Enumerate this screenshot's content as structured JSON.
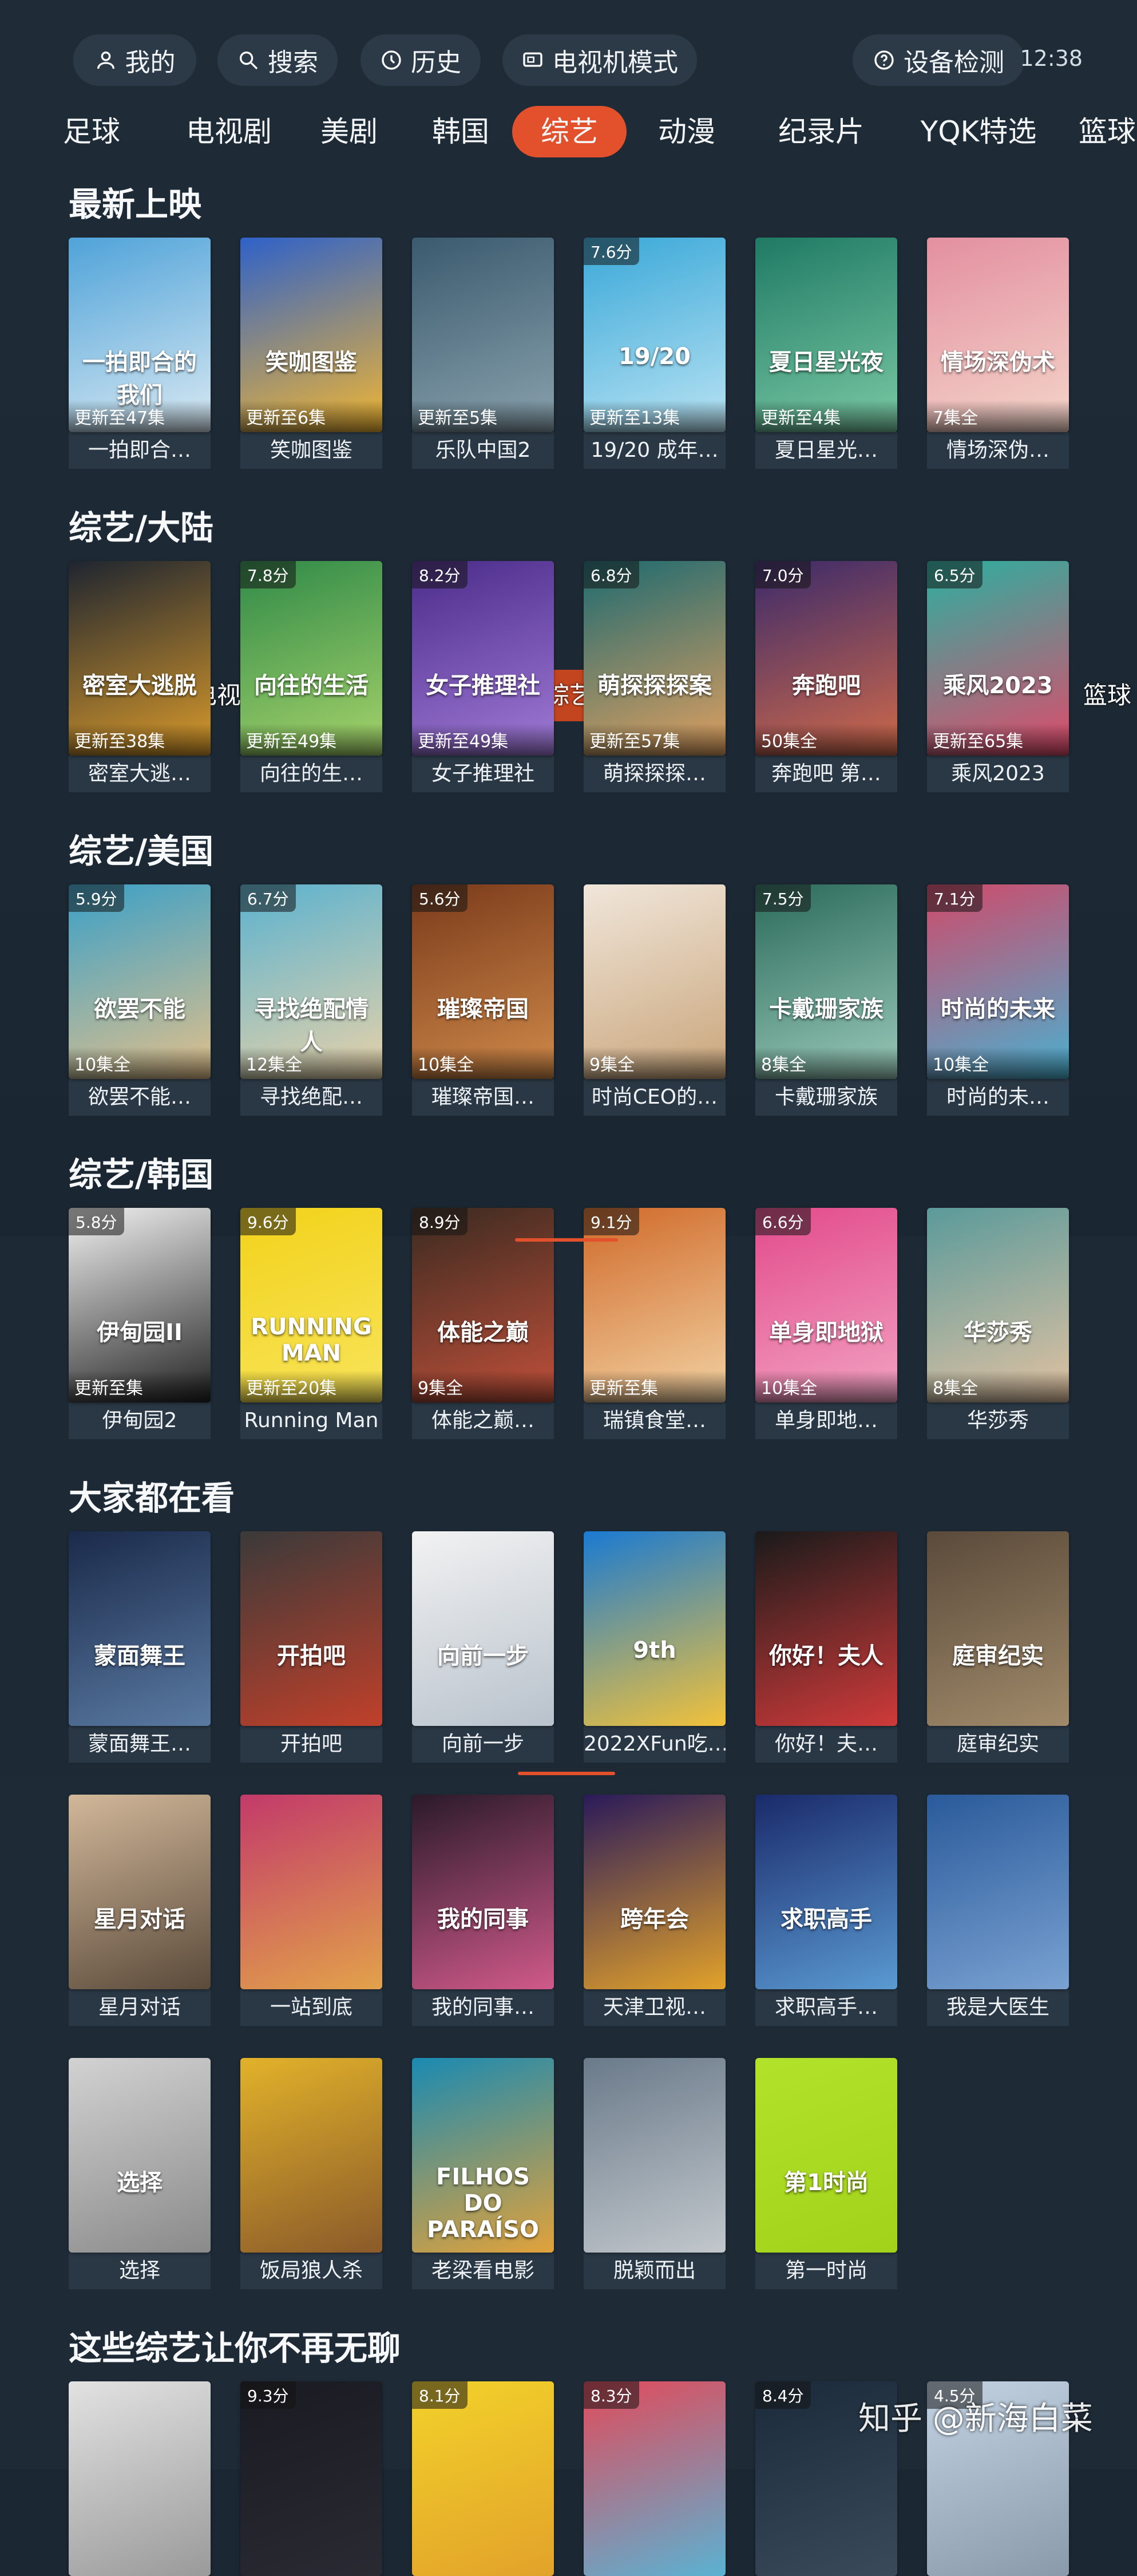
{
  "topbar": {
    "mine": "我的",
    "search": "搜索",
    "history": "历史",
    "tv_mode": "电视机模式",
    "device_check": "设备检测",
    "time": "12:38"
  },
  "tabs": [
    "足球",
    "电视剧",
    "美剧",
    "韩国",
    "综艺",
    "动漫",
    "纪录片",
    "YQK特选",
    "篮球"
  ],
  "active_tab": "综艺",
  "sections": [
    {
      "title": "最新上映",
      "items": [
        {
          "caption": "一拍即合…",
          "ep": "更新至47集",
          "score": "",
          "art": "一拍即合的我们",
          "c1": "#4fa3d9",
          "c2": "#d9e9f2"
        },
        {
          "caption": "笑咖图鉴",
          "ep": "更新至6集",
          "score": "",
          "art": "笑咖图鉴",
          "c1": "#2e61c9",
          "c2": "#f2b632"
        },
        {
          "caption": "乐队中国2",
          "ep": "更新至5集",
          "score": "",
          "art": "",
          "c1": "#3a5a6e",
          "c2": "#8aa2ad"
        },
        {
          "caption": "19/20 成年…",
          "ep": "更新至13集",
          "score": "7.6分",
          "art": "19/20",
          "c1": "#39a8d8",
          "c2": "#b9e3f3"
        },
        {
          "caption": "夏日星光…",
          "ep": "更新至4集",
          "score": "",
          "art": "夏日星光夜",
          "c1": "#1f7a64",
          "c2": "#7ac9a4"
        },
        {
          "caption": "情场深伪…",
          "ep": "7集全",
          "score": "",
          "art": "情场深伪术",
          "c1": "#e38fa0",
          "c2": "#f4d5c9"
        }
      ]
    },
    {
      "title": "综艺/大陆",
      "items": [
        {
          "caption": "密室大逃…",
          "ep": "更新至38集",
          "score": "",
          "art": "密室大逃脱",
          "c1": "#1e2530",
          "c2": "#d99a2b"
        },
        {
          "caption": "向往的生…",
          "ep": "更新至49集",
          "score": "7.8分",
          "art": "向往的生活",
          "c1": "#2f8a48",
          "c2": "#a6d36a"
        },
        {
          "caption": "女子推理社",
          "ep": "更新至49集",
          "score": "8.2分",
          "art": "女子推理社",
          "c1": "#4b2c8a",
          "c2": "#a07ad6"
        },
        {
          "caption": "萌探探探…",
          "ep": "更新至57集",
          "score": "6.8分",
          "art": "萌探探探案",
          "c1": "#1d6a70",
          "c2": "#e0a060"
        },
        {
          "caption": "奔跑吧 第…",
          "ep": "50集全",
          "score": "7.0分",
          "art": "奔跑吧",
          "c1": "#3a2a6a",
          "c2": "#d06a4a"
        },
        {
          "caption": "乘风2023",
          "ep": "更新至65集",
          "score": "6.5分",
          "art": "乘风2023",
          "c1": "#2bb0a0",
          "c2": "#e04a6a"
        }
      ]
    },
    {
      "title": "综艺/美国",
      "items": [
        {
          "caption": "欲罢不能…",
          "ep": "10集全",
          "score": "5.9分",
          "art": "欲罢不能",
          "c1": "#3aa0c8",
          "c2": "#e2c08a"
        },
        {
          "caption": "寻找绝配…",
          "ep": "12集全",
          "score": "6.7分",
          "art": "寻找绝配情人",
          "c1": "#5ab2d0",
          "c2": "#e8d2a8"
        },
        {
          "caption": "璀璨帝国…",
          "ep": "10集全",
          "score": "5.6分",
          "art": "璀璨帝国",
          "c1": "#7a3a1a",
          "c2": "#d08a4a"
        },
        {
          "caption": "时尚CEO的…",
          "ep": "9集全",
          "score": "",
          "art": "",
          "c1": "#f0e6da",
          "c2": "#c9a57a"
        },
        {
          "caption": "卡戴珊家族",
          "ep": "8集全",
          "score": "7.5分",
          "art": "卡戴珊家族",
          "c1": "#2a6a5a",
          "c2": "#9ac9b9"
        },
        {
          "caption": "时尚的未…",
          "ep": "10集全",
          "score": "7.1分",
          "art": "时尚的未来",
          "c1": "#d04a6a",
          "c2": "#4ab0d0"
        }
      ]
    },
    {
      "title": "综艺/韩国",
      "items": [
        {
          "caption": "伊甸园2",
          "ep": "更新至集",
          "score": "5.8分",
          "art": "伊甸园II",
          "c1": "#f2f2f2",
          "c2": "#222222"
        },
        {
          "caption": "Running Man",
          "ep": "更新至20集",
          "score": "9.6分",
          "art": "RUNNING MAN",
          "c1": "#f2d21a",
          "c2": "#f8e45a"
        },
        {
          "caption": "体能之巅…",
          "ep": "9集全",
          "score": "8.9分",
          "art": "体能之巅",
          "c1": "#3a2a20",
          "c2": "#c0503a"
        },
        {
          "caption": "瑞镇食堂…",
          "ep": "更新至集",
          "score": "9.1分",
          "art": "",
          "c1": "#d06a2a",
          "c2": "#f2d2a2"
        },
        {
          "caption": "单身即地…",
          "ep": "10集全",
          "score": "6.6分",
          "art": "单身即地狱",
          "c1": "#e24a8a",
          "c2": "#f2a2c2"
        },
        {
          "caption": "华莎秀",
          "ep": "8集全",
          "score": "",
          "art": "华莎秀",
          "c1": "#5a9a9a",
          "c2": "#e2c2a2"
        }
      ]
    },
    {
      "title": "大家都在看",
      "items": [
        {
          "caption": "蒙面舞王…",
          "ep": "",
          "score": "",
          "art": "蒙面舞王",
          "c1": "#1a2a4a",
          "c2": "#5a7aa2"
        },
        {
          "caption": "开拍吧",
          "ep": "",
          "score": "",
          "art": "开拍吧",
          "c1": "#3a3a3a",
          "c2": "#c0402a"
        },
        {
          "caption": "向前一步",
          "ep": "",
          "score": "",
          "art": "向前一步",
          "c1": "#f2f2f2",
          "c2": "#b8c2cc"
        },
        {
          "caption": "2022XFun吃…",
          "ep": "",
          "score": "",
          "art": "9th",
          "c1": "#1a7ad2",
          "c2": "#f2c23a"
        },
        {
          "caption": "你好！夫…",
          "ep": "",
          "score": "",
          "art": "你好！夫人",
          "c1": "#1a1a1a",
          "c2": "#d03a3a"
        },
        {
          "caption": "庭审纪实",
          "ep": "",
          "score": "",
          "art": "庭审纪实",
          "c1": "#5a4a3a",
          "c2": "#a08a6a"
        }
      ]
    },
    {
      "title": "",
      "items": [
        {
          "caption": "星月对话",
          "ep": "",
          "score": "",
          "art": "星月对话",
          "c1": "#d2b89a",
          "c2": "#5a4a3a"
        },
        {
          "caption": "一站到底",
          "ep": "",
          "score": "",
          "art": "",
          "c1": "#c23a6a",
          "c2": "#e2a24a"
        },
        {
          "caption": "我的同事…",
          "ep": "",
          "score": "",
          "art": "我的同事",
          "c1": "#2a1a2a",
          "c2": "#d05a8a"
        },
        {
          "caption": "天津卫视…",
          "ep": "",
          "score": "",
          "art": "跨年会",
          "c1": "#2a1a5a",
          "c2": "#e2a22a"
        },
        {
          "caption": "求职高手…",
          "ep": "",
          "score": "",
          "art": "求职高手",
          "c1": "#1a2a6a",
          "c2": "#5a9ad2"
        },
        {
          "caption": "我是大医生",
          "ep": "",
          "score": "",
          "art": "",
          "c1": "#2a5a9a",
          "c2": "#7aa2d2"
        }
      ]
    },
    {
      "title": "",
      "items": [
        {
          "caption": "选择",
          "ep": "",
          "score": "",
          "art": "选择",
          "c1": "#d2d2d2",
          "c2": "#8a8a8a"
        },
        {
          "caption": "饭局狼人杀",
          "ep": "",
          "score": "",
          "art": "",
          "c1": "#e2b22a",
          "c2": "#8a5a2a"
        },
        {
          "caption": "老梁看电影",
          "ep": "",
          "score": "",
          "art": "FILHOS DO PARAÍSO",
          "c1": "#1a8ab2",
          "c2": "#e2a23a"
        },
        {
          "caption": "脱颖而出",
          "ep": "",
          "score": "",
          "art": "",
          "c1": "#6a7a8a",
          "c2": "#c2c8cc"
        },
        {
          "caption": "第一时尚",
          "ep": "",
          "score": "",
          "art": "第1时尚",
          "c1": "#b2e22a",
          "c2": "#a2d21a"
        }
      ]
    },
    {
      "title": "这些综艺让你不再无聊",
      "items": [
        {
          "caption": "",
          "ep": "",
          "score": "",
          "art": "",
          "c1": "#e2e2e2",
          "c2": "#9a9a9a"
        },
        {
          "caption": "",
          "ep": "",
          "score": "9.3分",
          "art": "",
          "c1": "#1a1a22",
          "c2": "#2a2a33"
        },
        {
          "caption": "",
          "ep": "",
          "score": "8.1分",
          "art": "",
          "c1": "#f2d22a",
          "c2": "#e2a22a"
        },
        {
          "caption": "",
          "ep": "",
          "score": "8.3分",
          "art": "",
          "c1": "#e24a5a",
          "c2": "#5ab2d2"
        },
        {
          "caption": "",
          "ep": "",
          "score": "8.4分",
          "art": "",
          "c1": "#1a2a3a",
          "c2": "#3a4a5a"
        },
        {
          "caption": "",
          "ep": "",
          "score": "4.5分",
          "art": "",
          "c1": "#c2d2e2",
          "c2": "#8a9aaa"
        }
      ]
    }
  ],
  "watermark": "知乎 @新海白菜"
}
